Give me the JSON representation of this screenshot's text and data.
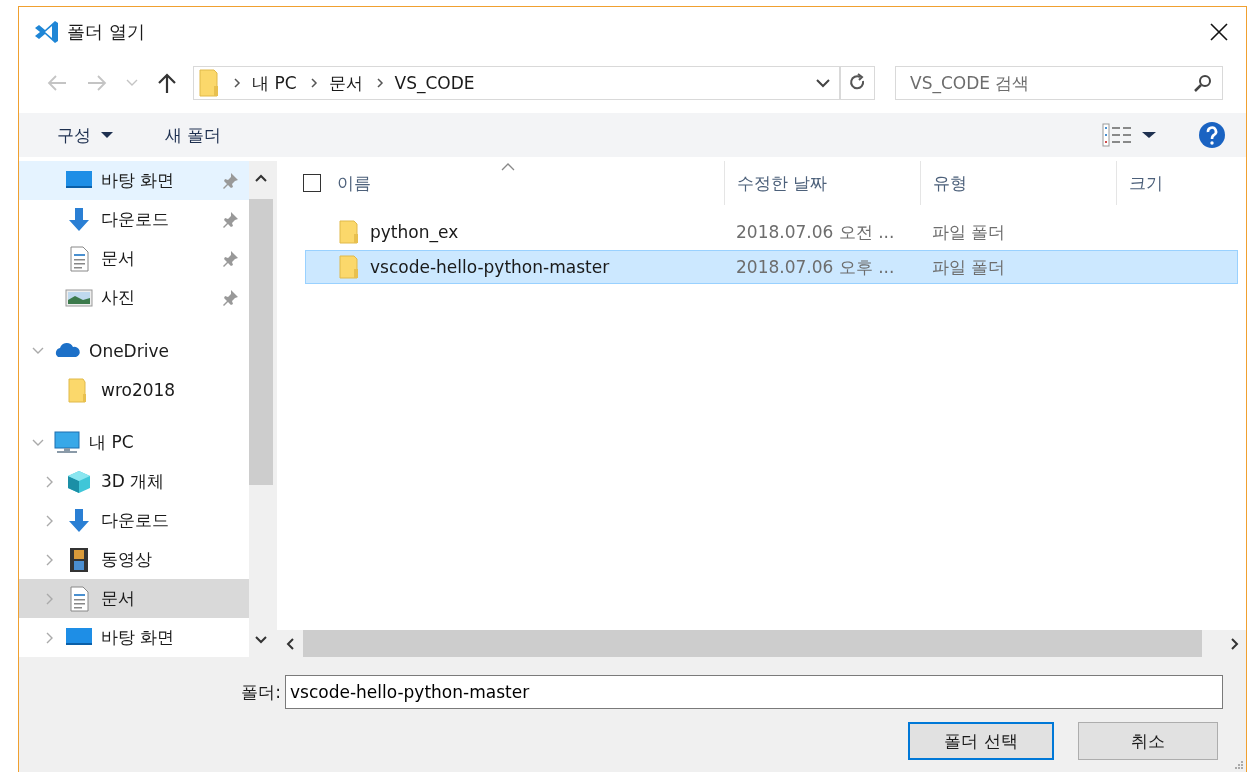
{
  "window": {
    "title": "폴더 열기"
  },
  "nav_buttons": [
    {
      "kind": "back",
      "disabled": true
    },
    {
      "kind": "forward",
      "disabled": true
    },
    {
      "kind": "recent",
      "disabled": true
    },
    {
      "kind": "up",
      "disabled": false
    }
  ],
  "address_bar": {
    "segments": [
      "내 PC",
      "문서",
      "VS_CODE"
    ]
  },
  "search": {
    "placeholder": "VS_CODE 검색"
  },
  "toolbar": {
    "organize": "구성",
    "new_folder": "새 폴더"
  },
  "sidebar": {
    "quick_access": [
      {
        "label": "바탕 화면",
        "kind": "desktop",
        "pinned": true,
        "hovered": true,
        "selected": false
      },
      {
        "label": "다운로드",
        "kind": "downloads",
        "pinned": true,
        "hovered": false,
        "selected": false
      },
      {
        "label": "문서",
        "kind": "documents",
        "pinned": true,
        "hovered": false,
        "selected": false
      },
      {
        "label": "사진",
        "kind": "pictures",
        "pinned": true,
        "hovered": false,
        "selected": false
      }
    ],
    "tree": [
      {
        "label": "OneDrive",
        "kind": "cloud",
        "expanded": true,
        "hovered": false,
        "selected": false,
        "children": [
          {
            "label": "wro2018",
            "kind": "folder",
            "hovered": false,
            "selected": false
          }
        ]
      },
      {
        "label": "내 PC",
        "kind": "computer",
        "expanded": true,
        "hovered": false,
        "selected": false,
        "children": [
          {
            "label": "3D 개체",
            "kind": "objects3d",
            "expanded": false,
            "hovered": false,
            "selected": false
          },
          {
            "label": "다운로드",
            "kind": "downloads",
            "expanded": false,
            "hovered": false,
            "selected": false
          },
          {
            "label": "동영상",
            "kind": "videos",
            "expanded": false,
            "hovered": false,
            "selected": false
          },
          {
            "label": "문서",
            "kind": "documents",
            "expanded": false,
            "hovered": false,
            "selected": true
          },
          {
            "label": "바탕 화면",
            "kind": "desktop",
            "expanded": false,
            "hovered": false,
            "selected": false
          }
        ]
      }
    ]
  },
  "file_list": {
    "select_all_checked": false,
    "columns": [
      {
        "label": "이름",
        "sorted": true
      },
      {
        "label": "수정한 날짜",
        "sorted": false
      },
      {
        "label": "유형",
        "sorted": false
      },
      {
        "label": "크기",
        "sorted": false
      }
    ],
    "rows": [
      {
        "name": "python_ex",
        "modified": "2018.07.06 오전 ...",
        "type": "파일 폴더",
        "selected": false
      },
      {
        "name": "vscode-hello-python-master",
        "modified": "2018.07.06 오후 ...",
        "type": "파일 폴더",
        "selected": true
      }
    ]
  },
  "folder_field": {
    "label": "폴더:",
    "value": "vscode-hello-python-master"
  },
  "buttons": [
    {
      "label": "폴더 선택",
      "default": true
    },
    {
      "label": "취소",
      "default": false
    }
  ]
}
